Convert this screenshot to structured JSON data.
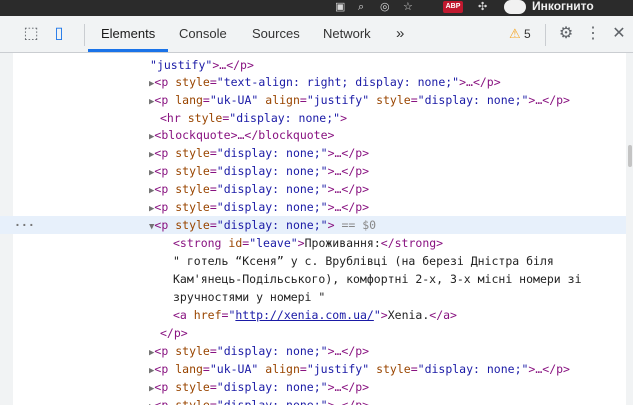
{
  "browser": {
    "abp_badge": "ABP",
    "incognito_label": "Инкогнито"
  },
  "devtools": {
    "tabs": [
      "Elements",
      "Console",
      "Sources",
      "Network"
    ],
    "more_tabs": "»",
    "warnings_count": "5"
  },
  "tree": {
    "r0": {
      "a": "justify",
      "b": ">…</",
      "c": "p",
      "d": ">"
    },
    "r1": {
      "attr_val": "\"text-align: right; display: none;\""
    },
    "r2": {
      "lang": "\"uk-UA\"",
      "align": "\"justify\"",
      "style": "\"display: none;\""
    },
    "r3": {
      "style": "\"display: none;\""
    },
    "r4": {
      "tag": "blockquote"
    },
    "p_none": "\"display: none;\"",
    "sel_marker": "== $0",
    "strong_id": "\"leave\"",
    "strong_text": "Проживання:",
    "t1": "\" готель “Ксеня” у с. Врублівці (на березі Дністра біля",
    "t2": "Кам'янець-Подільського), комфортні 2-х, 3-х місні номери зі",
    "t3": "зручностями у номері \"",
    "href": "\"http://xenia.com.ua/\"",
    "link_text": "Xenia.",
    "close_p": "</p>"
  }
}
